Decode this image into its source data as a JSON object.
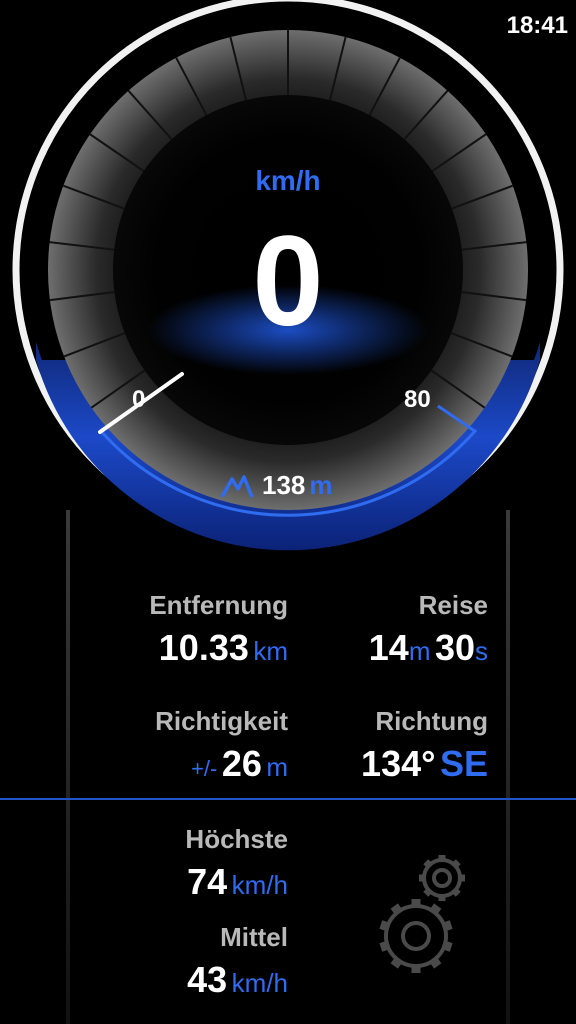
{
  "status": {
    "time": "18:41"
  },
  "gauge": {
    "unit": "km/h",
    "speed": "0",
    "scale_min": "0",
    "scale_max": "80",
    "speed_fraction": 0.0,
    "accent_color": "#2f6cf0"
  },
  "altitude": {
    "icon": "mountain-icon",
    "value": "138",
    "unit": "m"
  },
  "stats": {
    "distance": {
      "label": "Entfernung",
      "value": "10.33",
      "unit": "km"
    },
    "trip": {
      "label": "Reise",
      "minutes": "14",
      "min_unit": "m",
      "seconds": "30",
      "sec_unit": "s"
    },
    "accuracy": {
      "label": "Richtigkeit",
      "prefix": "+/-",
      "value": "26",
      "unit": "m"
    },
    "heading": {
      "label": "Richtung",
      "value": "134°",
      "direction": "SE"
    },
    "max": {
      "label": "Höchste",
      "value": "74",
      "unit": "km/h"
    },
    "avg": {
      "label": "Mittel",
      "value": "43",
      "unit": "km/h"
    }
  },
  "settings": {
    "icon": "gears-icon"
  }
}
